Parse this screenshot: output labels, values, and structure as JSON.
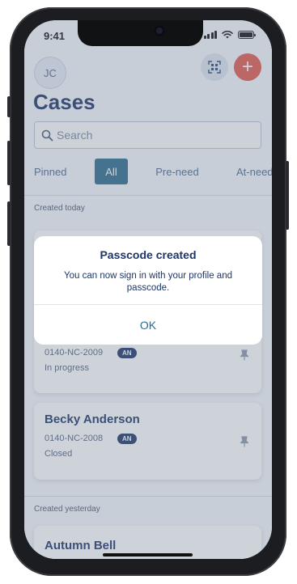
{
  "status_bar": {
    "time": "9:41"
  },
  "header": {
    "avatar_initials": "JC",
    "title": "Cases",
    "qr_icon": "qr-scan-icon",
    "add_icon": "plus-icon",
    "add_symbol": "+"
  },
  "search": {
    "placeholder": "Search"
  },
  "filter_tabs": [
    {
      "label": "Pinned",
      "active": false
    },
    {
      "label": "All",
      "active": true
    },
    {
      "label": "Pre-need",
      "active": false
    },
    {
      "label": "At-need",
      "active": false
    }
  ],
  "sections": {
    "today": "Created today",
    "yesterday": "Created yesterday"
  },
  "cases": [
    {
      "name": "",
      "case_id": "0140-NC-2009",
      "badge": "AN",
      "status": "In progress"
    },
    {
      "name": "Becky Anderson",
      "case_id": "0140-NC-2008",
      "badge": "AN",
      "status": "Closed"
    },
    {
      "name": "Autumn Bell"
    }
  ],
  "dialog": {
    "title": "Passcode created",
    "message": "You can now sign in with your profile and passcode.",
    "ok_label": "OK"
  },
  "colors": {
    "primary": "#1e3567",
    "accent": "#2c6b8c",
    "add_button": "#e05a4c",
    "scrim": "#74809659"
  }
}
